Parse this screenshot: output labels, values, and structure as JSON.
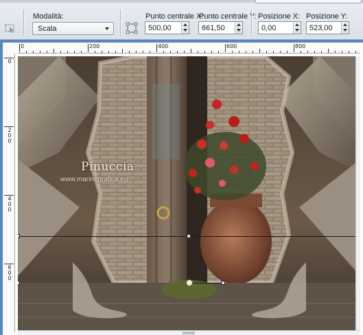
{
  "toolbar": {
    "mode_label": "Modalità:",
    "mode_value": "Scala",
    "center_x_label": "Punto centrale X:",
    "center_x_value": "500,00",
    "center_y_label": "Punto centrale Y:",
    "center_y_value": "661,50",
    "pos_x_label": "Posizione X:",
    "pos_x_value": "0,00",
    "pos_y_label": "Posizione Y:",
    "pos_y_value": "523,00"
  },
  "ruler_h": {
    "labels": [
      "0",
      "200",
      "400",
      "600",
      "800"
    ]
  },
  "ruler_v": {
    "labels": [
      "0",
      "200",
      "400",
      "600"
    ]
  },
  "canvas": {
    "watermark_title": "Pinuccia",
    "watermark_url": "www.marinegrafica.eu"
  },
  "icons": {
    "pick_tool": "pick-tool-icon",
    "reset": "reset-icon"
  }
}
